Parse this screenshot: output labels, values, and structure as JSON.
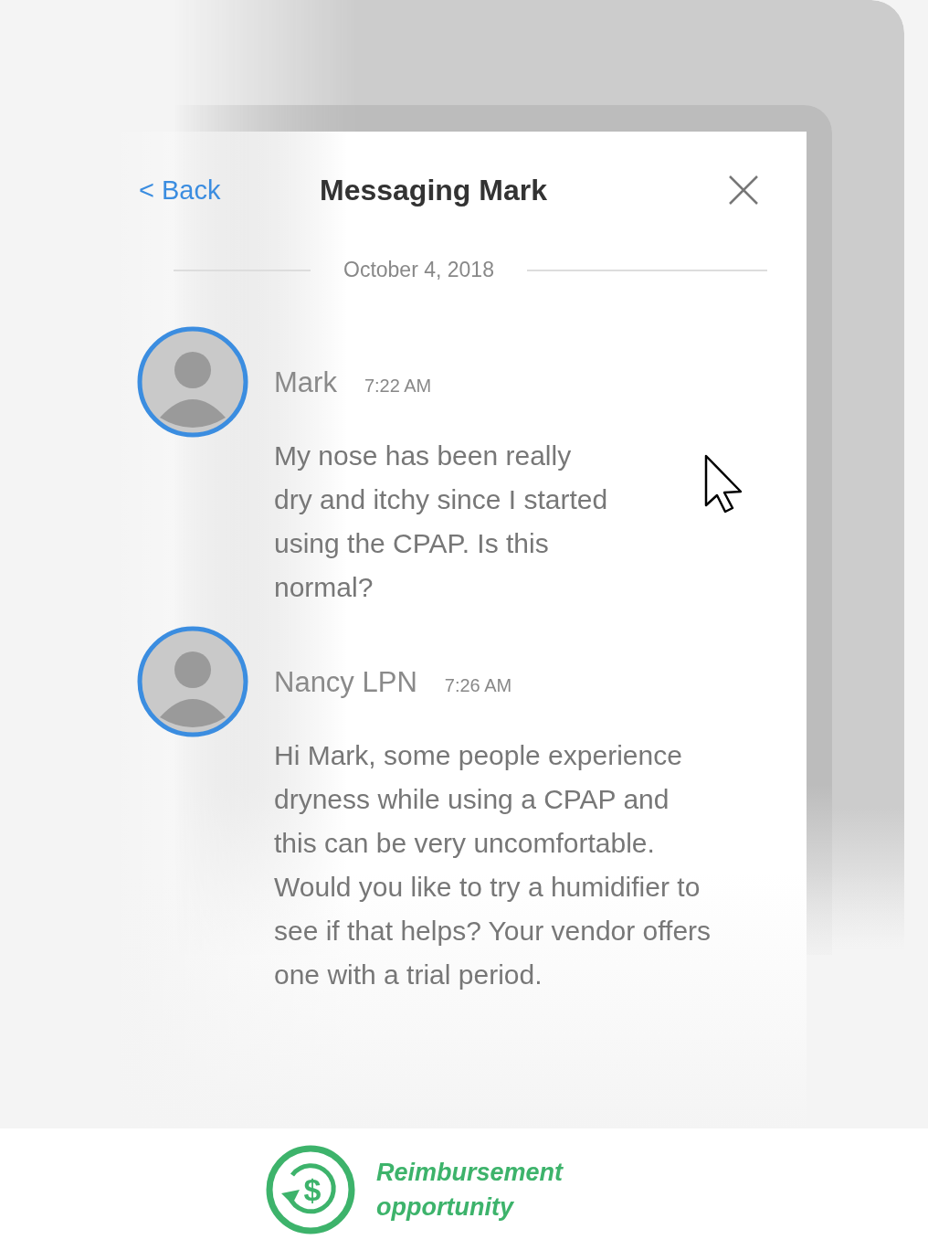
{
  "header": {
    "back": "< Back",
    "title": "Messaging Mark"
  },
  "date": "October 4, 2018",
  "messages": [
    {
      "sender": "Mark",
      "time": "7:22 AM",
      "text": "My nose has been really dry and itchy since I started using the CPAP. Is this normal?"
    },
    {
      "sender": "Nancy LPN",
      "time": "7:26 AM",
      "text": "Hi Mark, some people experience dryness while using a CPAP and this can be very uncomfortable. Would you like to try a humidifier to see if that helps? Your vendor offers one with a trial period."
    }
  ],
  "callout": {
    "symbol": "$",
    "label": "Reimbursement opportunity"
  }
}
